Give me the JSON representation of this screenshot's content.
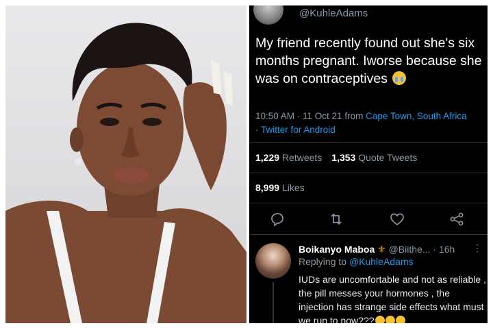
{
  "tweet": {
    "handle": "@KuhleAdams",
    "text": "My friend recently found out she's six months pregnant. Iworse because she was on contraceptives",
    "emoji_icon": "loudly-crying-face-icon",
    "time_date": "10:50 AM · 11 Oct 21 from ",
    "location": "Cape Town, South Africa",
    "client_prefix": "· ",
    "client": "Twitter for Android",
    "retweets_count": "1,229",
    "retweets_label": "Retweets",
    "quote_count": "1,353",
    "quote_label": "Quote Tweets",
    "likes_count": "8,999",
    "likes_label": "Likes"
  },
  "actions": {
    "icons": [
      "reply-icon",
      "retweet-icon",
      "like-icon",
      "share-icon"
    ]
  },
  "reply": {
    "name": "Boikanyo Maboa",
    "badge": "⚜",
    "handle": "@Biithe...",
    "time": "· 16h",
    "more": "⋮",
    "replying_prefix": "Replying to ",
    "replying_to": "@KuhleAdams",
    "text": "IUDs are uncomfortable and not as reliable , the pill messes your hormones , the injection has strange side effects what must we run to now???"
  },
  "colors": {
    "background": "#000000",
    "link": "#1d9bf0",
    "muted": "#8b98a5",
    "text": "#e7e9ea"
  }
}
